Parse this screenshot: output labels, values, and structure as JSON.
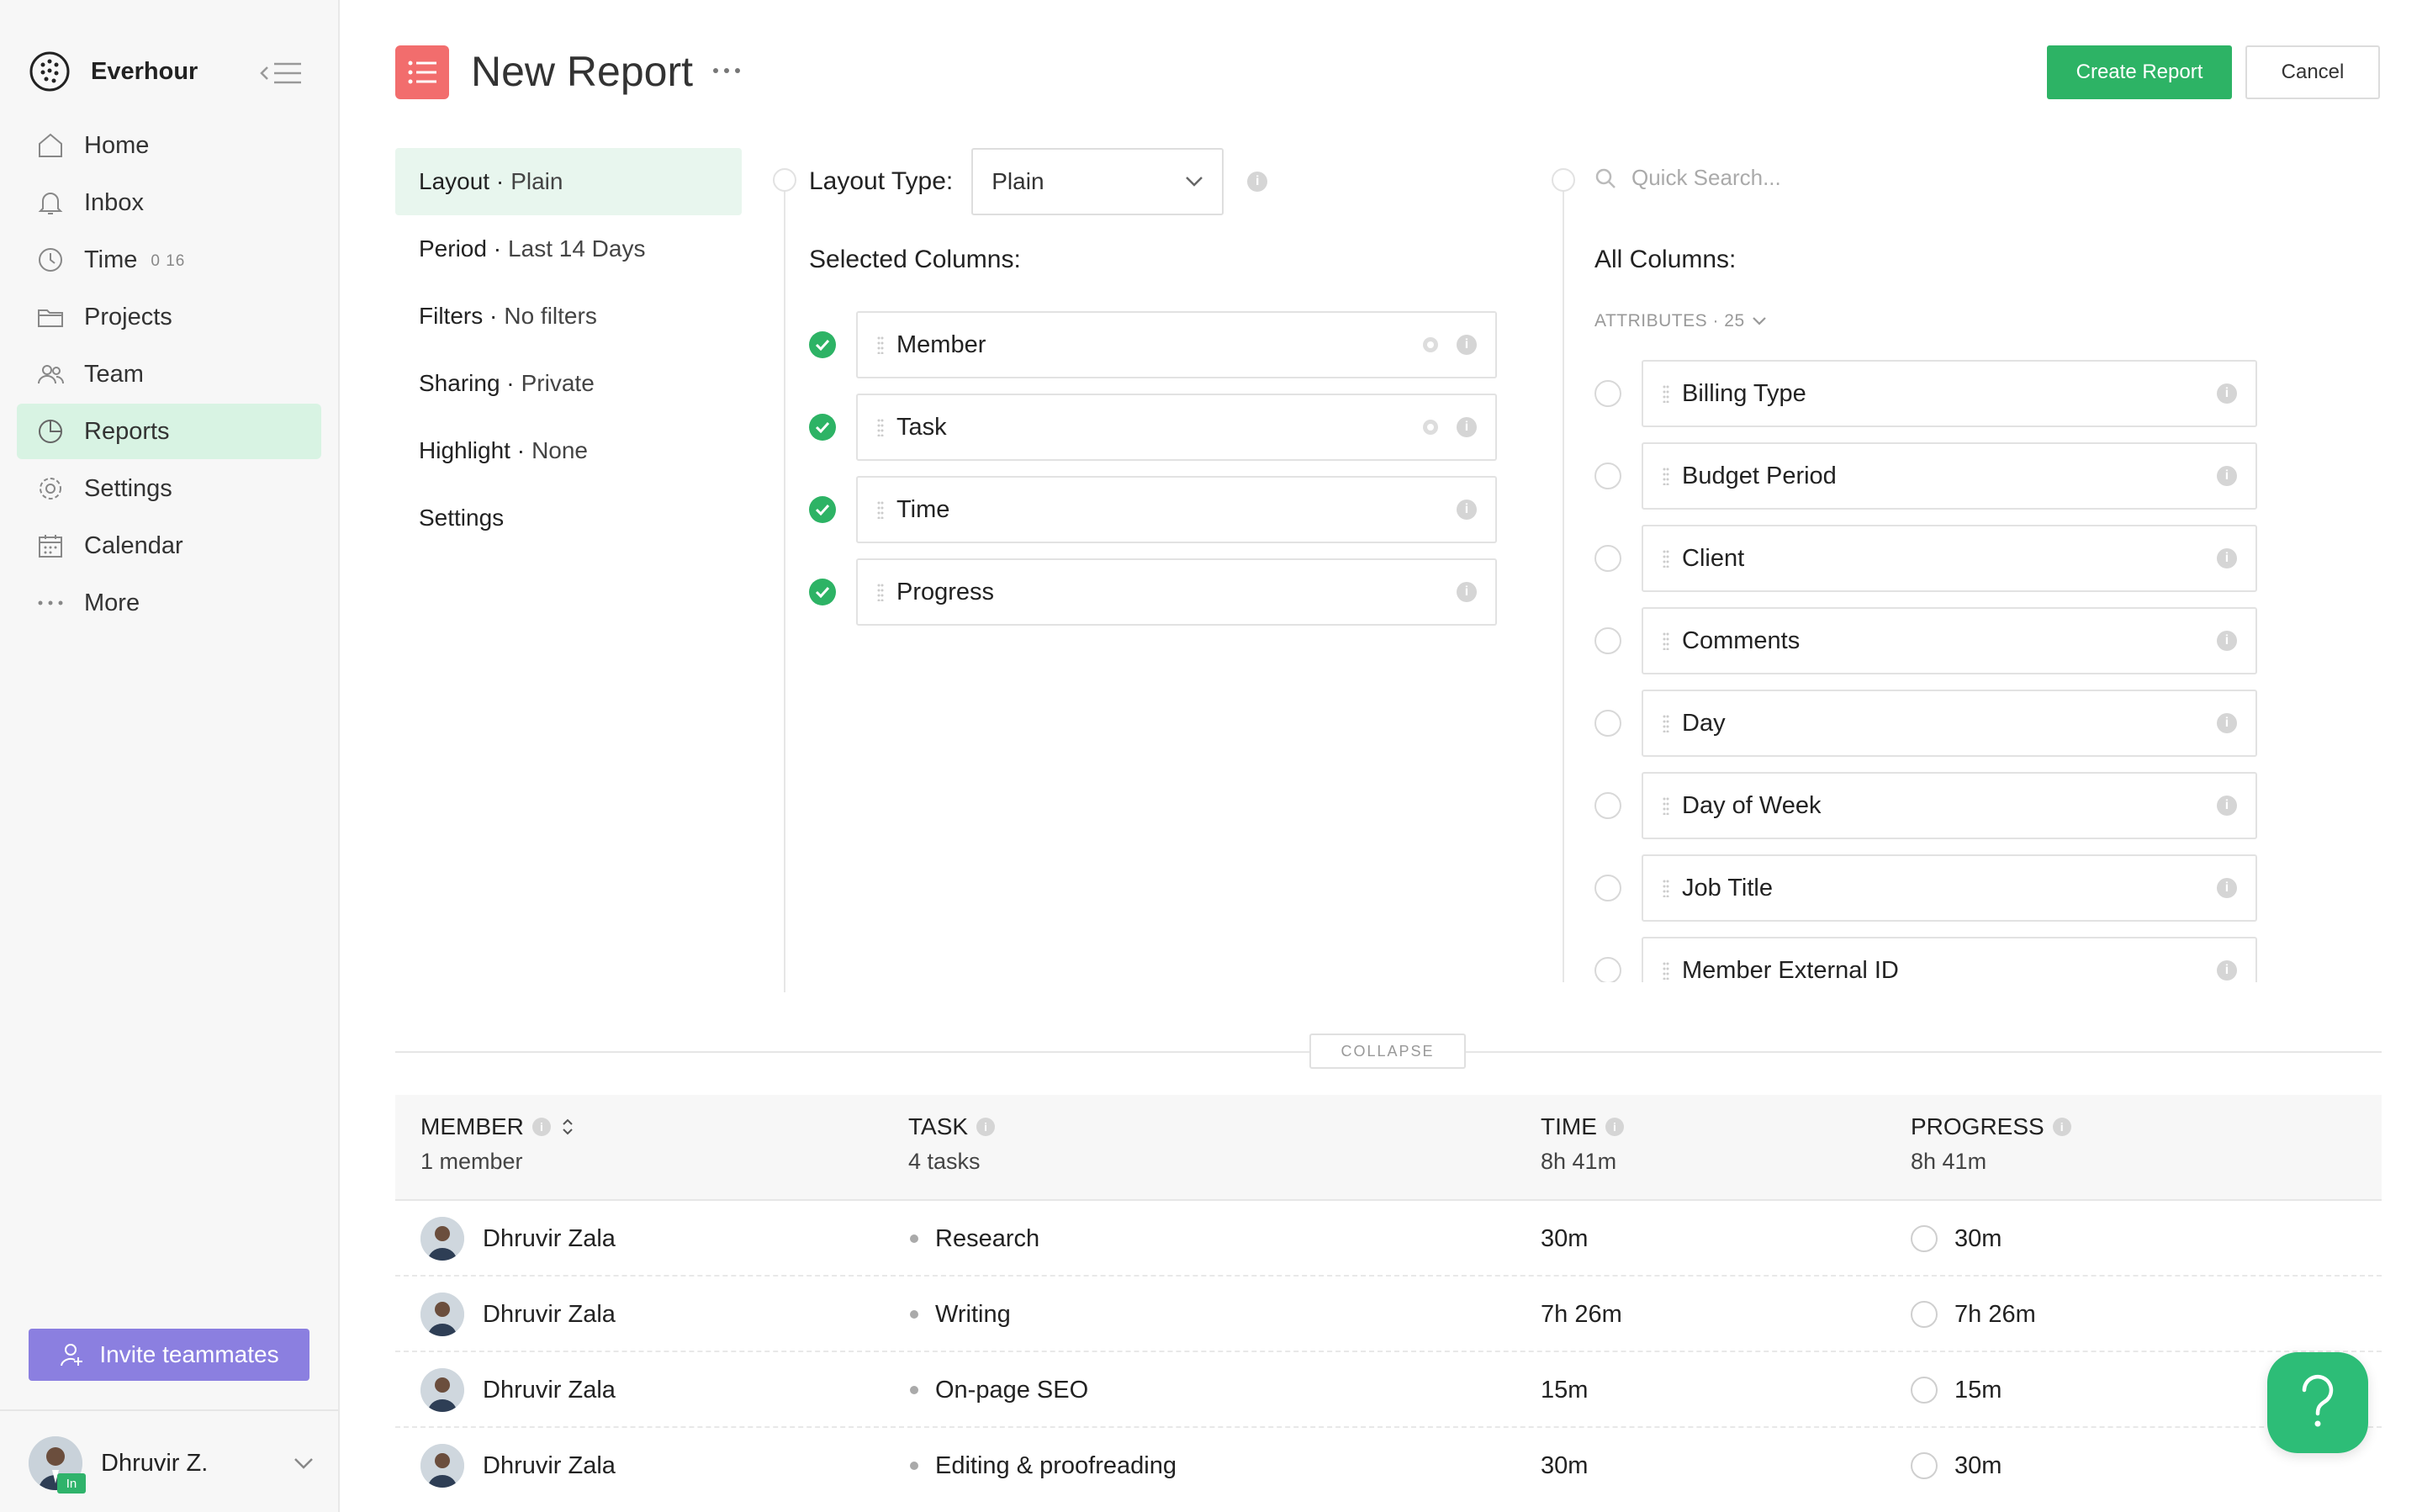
{
  "app": {
    "name": "Everhour"
  },
  "sidebar": {
    "items": [
      {
        "label": "Home",
        "icon": "home-icon"
      },
      {
        "label": "Inbox",
        "icon": "bell-icon"
      },
      {
        "label": "Time",
        "icon": "clock-icon",
        "count": "0 16"
      },
      {
        "label": "Projects",
        "icon": "folder-icon"
      },
      {
        "label": "Team",
        "icon": "users-icon"
      },
      {
        "label": "Reports",
        "icon": "pie-chart-icon",
        "active": true
      },
      {
        "label": "Settings",
        "icon": "gear-icon"
      },
      {
        "label": "Calendar",
        "icon": "calendar-icon"
      },
      {
        "label": "More",
        "icon": "dots-icon"
      }
    ],
    "invite_label": "Invite teammates",
    "user": {
      "name": "Dhruvir Z.",
      "badge": "In"
    }
  },
  "header": {
    "title": "New Report",
    "create_label": "Create Report",
    "cancel_label": "Cancel"
  },
  "settings_menu": [
    {
      "key": "Layout",
      "value": "Plain",
      "active": true
    },
    {
      "key": "Period",
      "value": "Last 14 Days"
    },
    {
      "key": "Filters",
      "value": "No filters"
    },
    {
      "key": "Sharing",
      "value": "Private"
    },
    {
      "key": "Highlight",
      "value": "None"
    },
    {
      "key": "Settings",
      "value": ""
    }
  ],
  "layout": {
    "label": "Layout Type:",
    "value": "Plain"
  },
  "selected": {
    "title": "Selected Columns:",
    "columns": [
      {
        "label": "Member",
        "gear": true
      },
      {
        "label": "Task",
        "gear": true
      },
      {
        "label": "Time",
        "gear": false
      },
      {
        "label": "Progress",
        "gear": false
      }
    ]
  },
  "all_columns": {
    "search_placeholder": "Quick Search...",
    "title": "All Columns:",
    "group_label": "ATTRIBUTES · 25",
    "columns": [
      "Billing Type",
      "Budget Period",
      "Client",
      "Comments",
      "Day",
      "Day of Week",
      "Job Title",
      "Member External ID"
    ]
  },
  "collapse_label": "COLLAPSE",
  "table": {
    "headers": [
      {
        "title": "MEMBER",
        "sub": "1 member"
      },
      {
        "title": "TASK",
        "sub": "4 tasks"
      },
      {
        "title": "TIME",
        "sub": "8h 41m"
      },
      {
        "title": "PROGRESS",
        "sub": "8h 41m"
      }
    ],
    "rows": [
      {
        "member": "Dhruvir Zala",
        "task": "Research",
        "time": "30m",
        "progress": "30m"
      },
      {
        "member": "Dhruvir Zala",
        "task": "Writing",
        "time": "7h 26m",
        "progress": "7h 26m"
      },
      {
        "member": "Dhruvir Zala",
        "task": "On-page SEO",
        "time": "15m",
        "progress": "15m"
      },
      {
        "member": "Dhruvir Zala",
        "task": "Editing & proofreading",
        "time": "30m",
        "progress": "30m"
      }
    ]
  },
  "colors": {
    "accent_green": "#2db365",
    "active_nav_bg": "#d8f3e3",
    "report_icon_red": "#f26d6d",
    "invite_purple": "#8b7fe0",
    "help_green": "#2dbd77"
  }
}
